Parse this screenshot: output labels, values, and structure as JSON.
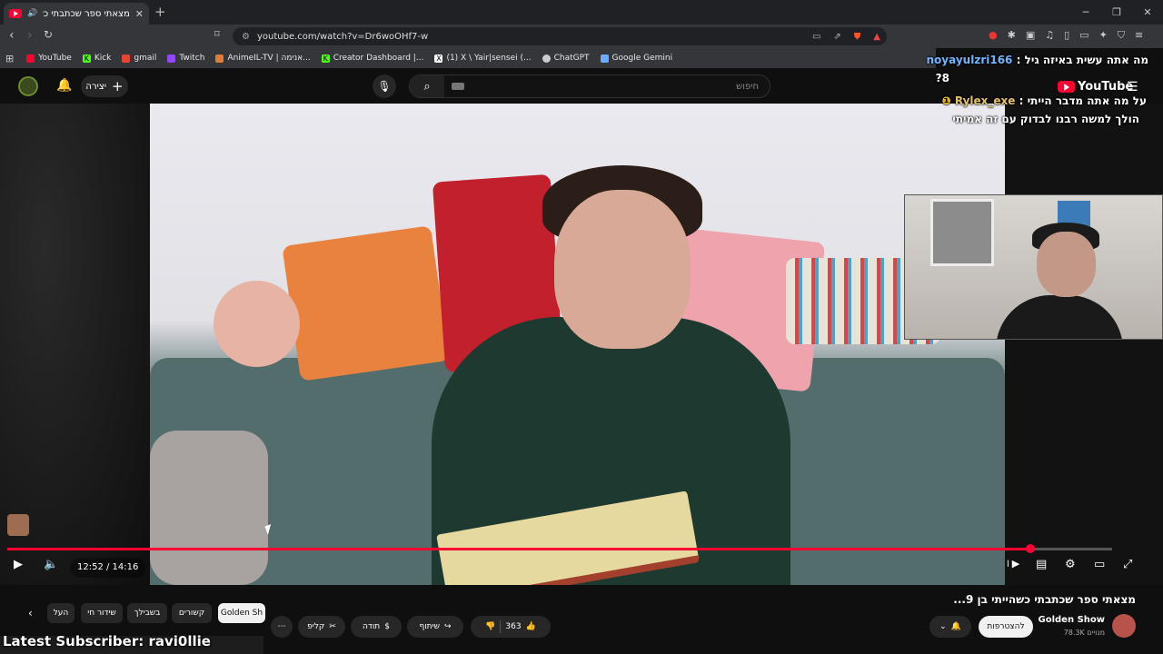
{
  "browser": {
    "tab_title": "מצאתי ספר שכתבתי כשהייתי",
    "url": "youtube.com/watch?v=Dr6woOHf7-w",
    "bookmarks": [
      {
        "label": "YouTube",
        "color": "#ff0033"
      },
      {
        "label": "Kick",
        "color": "#53fc18"
      },
      {
        "label": "gmail",
        "color": "#ea4335"
      },
      {
        "label": "Twitch",
        "color": "#9146ff"
      },
      {
        "label": "AnimeIL-TV | אנימה...",
        "color": "#e07b39"
      },
      {
        "label": "Creator Dashboard |...",
        "color": "#53fc18"
      },
      {
        "label": "(1) X \\ Yair|sensei (...",
        "color": "#ffffff"
      },
      {
        "label": "ChatGPT",
        "color": "#cccccc"
      },
      {
        "label": "Google Gemini",
        "color": "#6fa8ff"
      }
    ]
  },
  "youtube": {
    "create_label": "יצירה",
    "search_placeholder": "חיפוש",
    "logo_text": "YouTube",
    "player": {
      "time": "12:52 / 14:16",
      "progress": 0.926
    },
    "video_title": "מצאתי ספר שכתבתי כשהייתי בן 9...",
    "channel_name": "Golden Show",
    "subscribers": "78.3K מנויים",
    "subscribe_label": "להצטרפות",
    "likes": "363",
    "share_label": "שיתוף",
    "thanks_label": "תודה",
    "clip_label": "קליפ",
    "chips": [
      "Golden Sh",
      "קשורים",
      "בשבילך",
      "שידור חי",
      "העל"
    ]
  },
  "overlay": {
    "chat_lines": [
      {
        "user": "noyayulzri166",
        "text": "מה אתה עשית באיזה גיל :",
        "user_color": "#6fb6ff"
      },
      {
        "user": "",
        "text": "8?",
        "user_color": ""
      },
      {
        "user": "Rylex_exe",
        "text": "על מה אתה מדבר הייתי :",
        "user_color": "#e0c26a"
      },
      {
        "user": "",
        "text": "הולך למשה רבנו לבדוק עם זה אמיתי",
        "user_color": ""
      }
    ],
    "latest_subscriber": "Latest Subscriber: ravi0llie"
  }
}
